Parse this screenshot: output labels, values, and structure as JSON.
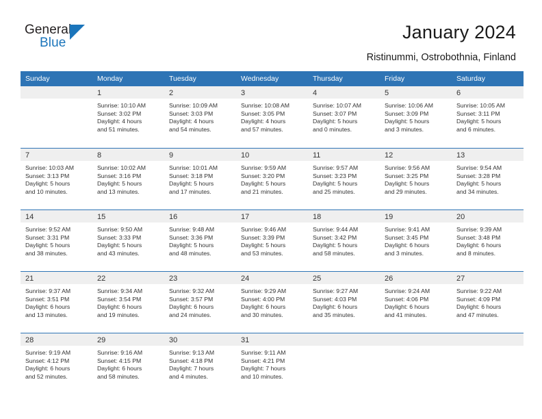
{
  "logo": {
    "word_top": "General",
    "word_bottom": "Blue",
    "triangle_icon": "triangle-icon",
    "brand_color": "#1b75bb"
  },
  "header": {
    "title": "January 2024",
    "subtitle": "Ristinummi, Ostrobothnia, Finland"
  },
  "theme": {
    "header_blue": "#2e74b5",
    "row_divider": "#2e74b5",
    "daynum_band": "#efefef",
    "text": "#333333"
  },
  "calendar": {
    "weekday_headers": [
      "Sunday",
      "Monday",
      "Tuesday",
      "Wednesday",
      "Thursday",
      "Friday",
      "Saturday"
    ],
    "weeks": [
      [
        {
          "day": "",
          "lines": []
        },
        {
          "day": "1",
          "lines": [
            "Sunrise: 10:10 AM",
            "Sunset: 3:02 PM",
            "Daylight: 4 hours",
            "and 51 minutes."
          ]
        },
        {
          "day": "2",
          "lines": [
            "Sunrise: 10:09 AM",
            "Sunset: 3:03 PM",
            "Daylight: 4 hours",
            "and 54 minutes."
          ]
        },
        {
          "day": "3",
          "lines": [
            "Sunrise: 10:08 AM",
            "Sunset: 3:05 PM",
            "Daylight: 4 hours",
            "and 57 minutes."
          ]
        },
        {
          "day": "4",
          "lines": [
            "Sunrise: 10:07 AM",
            "Sunset: 3:07 PM",
            "Daylight: 5 hours",
            "and 0 minutes."
          ]
        },
        {
          "day": "5",
          "lines": [
            "Sunrise: 10:06 AM",
            "Sunset: 3:09 PM",
            "Daylight: 5 hours",
            "and 3 minutes."
          ]
        },
        {
          "day": "6",
          "lines": [
            "Sunrise: 10:05 AM",
            "Sunset: 3:11 PM",
            "Daylight: 5 hours",
            "and 6 minutes."
          ]
        }
      ],
      [
        {
          "day": "7",
          "lines": [
            "Sunrise: 10:03 AM",
            "Sunset: 3:13 PM",
            "Daylight: 5 hours",
            "and 10 minutes."
          ]
        },
        {
          "day": "8",
          "lines": [
            "Sunrise: 10:02 AM",
            "Sunset: 3:16 PM",
            "Daylight: 5 hours",
            "and 13 minutes."
          ]
        },
        {
          "day": "9",
          "lines": [
            "Sunrise: 10:01 AM",
            "Sunset: 3:18 PM",
            "Daylight: 5 hours",
            "and 17 minutes."
          ]
        },
        {
          "day": "10",
          "lines": [
            "Sunrise: 9:59 AM",
            "Sunset: 3:20 PM",
            "Daylight: 5 hours",
            "and 21 minutes."
          ]
        },
        {
          "day": "11",
          "lines": [
            "Sunrise: 9:57 AM",
            "Sunset: 3:23 PM",
            "Daylight: 5 hours",
            "and 25 minutes."
          ]
        },
        {
          "day": "12",
          "lines": [
            "Sunrise: 9:56 AM",
            "Sunset: 3:25 PM",
            "Daylight: 5 hours",
            "and 29 minutes."
          ]
        },
        {
          "day": "13",
          "lines": [
            "Sunrise: 9:54 AM",
            "Sunset: 3:28 PM",
            "Daylight: 5 hours",
            "and 34 minutes."
          ]
        }
      ],
      [
        {
          "day": "14",
          "lines": [
            "Sunrise: 9:52 AM",
            "Sunset: 3:31 PM",
            "Daylight: 5 hours",
            "and 38 minutes."
          ]
        },
        {
          "day": "15",
          "lines": [
            "Sunrise: 9:50 AM",
            "Sunset: 3:33 PM",
            "Daylight: 5 hours",
            "and 43 minutes."
          ]
        },
        {
          "day": "16",
          "lines": [
            "Sunrise: 9:48 AM",
            "Sunset: 3:36 PM",
            "Daylight: 5 hours",
            "and 48 minutes."
          ]
        },
        {
          "day": "17",
          "lines": [
            "Sunrise: 9:46 AM",
            "Sunset: 3:39 PM",
            "Daylight: 5 hours",
            "and 53 minutes."
          ]
        },
        {
          "day": "18",
          "lines": [
            "Sunrise: 9:44 AM",
            "Sunset: 3:42 PM",
            "Daylight: 5 hours",
            "and 58 minutes."
          ]
        },
        {
          "day": "19",
          "lines": [
            "Sunrise: 9:41 AM",
            "Sunset: 3:45 PM",
            "Daylight: 6 hours",
            "and 3 minutes."
          ]
        },
        {
          "day": "20",
          "lines": [
            "Sunrise: 9:39 AM",
            "Sunset: 3:48 PM",
            "Daylight: 6 hours",
            "and 8 minutes."
          ]
        }
      ],
      [
        {
          "day": "21",
          "lines": [
            "Sunrise: 9:37 AM",
            "Sunset: 3:51 PM",
            "Daylight: 6 hours",
            "and 13 minutes."
          ]
        },
        {
          "day": "22",
          "lines": [
            "Sunrise: 9:34 AM",
            "Sunset: 3:54 PM",
            "Daylight: 6 hours",
            "and 19 minutes."
          ]
        },
        {
          "day": "23",
          "lines": [
            "Sunrise: 9:32 AM",
            "Sunset: 3:57 PM",
            "Daylight: 6 hours",
            "and 24 minutes."
          ]
        },
        {
          "day": "24",
          "lines": [
            "Sunrise: 9:29 AM",
            "Sunset: 4:00 PM",
            "Daylight: 6 hours",
            "and 30 minutes."
          ]
        },
        {
          "day": "25",
          "lines": [
            "Sunrise: 9:27 AM",
            "Sunset: 4:03 PM",
            "Daylight: 6 hours",
            "and 35 minutes."
          ]
        },
        {
          "day": "26",
          "lines": [
            "Sunrise: 9:24 AM",
            "Sunset: 4:06 PM",
            "Daylight: 6 hours",
            "and 41 minutes."
          ]
        },
        {
          "day": "27",
          "lines": [
            "Sunrise: 9:22 AM",
            "Sunset: 4:09 PM",
            "Daylight: 6 hours",
            "and 47 minutes."
          ]
        }
      ],
      [
        {
          "day": "28",
          "lines": [
            "Sunrise: 9:19 AM",
            "Sunset: 4:12 PM",
            "Daylight: 6 hours",
            "and 52 minutes."
          ]
        },
        {
          "day": "29",
          "lines": [
            "Sunrise: 9:16 AM",
            "Sunset: 4:15 PM",
            "Daylight: 6 hours",
            "and 58 minutes."
          ]
        },
        {
          "day": "30",
          "lines": [
            "Sunrise: 9:13 AM",
            "Sunset: 4:18 PM",
            "Daylight: 7 hours",
            "and 4 minutes."
          ]
        },
        {
          "day": "31",
          "lines": [
            "Sunrise: 9:11 AM",
            "Sunset: 4:21 PM",
            "Daylight: 7 hours",
            "and 10 minutes."
          ]
        },
        {
          "day": "",
          "lines": []
        },
        {
          "day": "",
          "lines": []
        },
        {
          "day": "",
          "lines": []
        }
      ]
    ]
  }
}
